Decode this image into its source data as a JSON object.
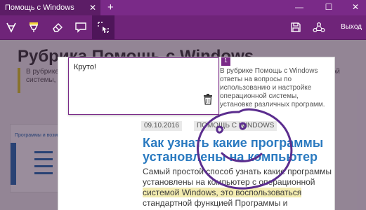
{
  "window": {
    "tab_title": "Помощь с Windows",
    "tab_close": "✕",
    "new_tab": "+",
    "minimize": "—",
    "maximize": "☐",
    "close": "✕"
  },
  "toolbar": {
    "tools": [
      {
        "icon": "pen-icon"
      },
      {
        "icon": "highlighter-icon",
        "accent": "#f1d33a"
      },
      {
        "icon": "eraser-icon"
      },
      {
        "icon": "note-icon"
      },
      {
        "icon": "clip-icon",
        "active": true
      }
    ],
    "save_icon": "save-icon",
    "share_icon": "share-icon",
    "exit_label": "Выход"
  },
  "page": {
    "title": "Рубрика Помощь с Windows",
    "description": "В рубрике Помощь с Windows ответы на вопросы по использованию и настройке операционной системы, установке различных программ.",
    "card_label": "Программы и возможности",
    "tag_date": "09.10.2016",
    "tag_category": "ПОМОЩЬ С WINDOWS",
    "headline": "Как узнать какие программы установлены на компьютер",
    "body_before": "Самый простой способ узнать какие программы установлены на компьютер с операционной ",
    "body_highlight": "системой Windows, это воспользоваться",
    "body_after": " стандартной функцией Программы и компоненты."
  },
  "note": {
    "text": "Круто!",
    "delete_icon": "trash-icon",
    "marker": "1"
  },
  "colors": {
    "accent": "#7a2a88",
    "toolbar": "#6f2479",
    "link": "#2a7ac0",
    "ink": "#5b2d8e",
    "highlight": "#f3ecb0"
  }
}
